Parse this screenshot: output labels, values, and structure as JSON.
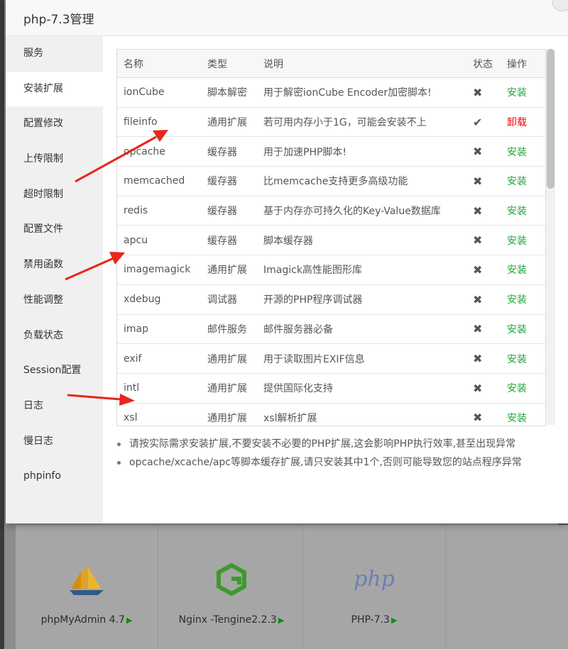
{
  "dialog": {
    "title": "php-7.3管理"
  },
  "sidebar": {
    "items": [
      {
        "label": "服务"
      },
      {
        "label": "安装扩展"
      },
      {
        "label": "配置修改"
      },
      {
        "label": "上传限制"
      },
      {
        "label": "超时限制"
      },
      {
        "label": "配置文件"
      },
      {
        "label": "禁用函数"
      },
      {
        "label": "性能调整"
      },
      {
        "label": "负载状态"
      },
      {
        "label": "Session配置"
      },
      {
        "label": "日志"
      },
      {
        "label": "慢日志"
      },
      {
        "label": "phpinfo"
      }
    ],
    "active_index": 1
  },
  "table": {
    "headers": {
      "name": "名称",
      "type": "类型",
      "desc": "说明",
      "status": "状态",
      "action": "操作"
    },
    "rows": [
      {
        "name": "ionCube",
        "type": "脚本解密",
        "desc": "用于解密ionCube Encoder加密脚本!",
        "status": "✖",
        "installed": false,
        "action": "安装"
      },
      {
        "name": "fileinfo",
        "type": "通用扩展",
        "desc": "若可用内存小于1G，可能会安装不上",
        "status": "✔",
        "installed": true,
        "action": "卸载"
      },
      {
        "name": "opcache",
        "type": "缓存器",
        "desc": "用于加速PHP脚本!",
        "status": "✖",
        "installed": false,
        "action": "安装"
      },
      {
        "name": "memcached",
        "type": "缓存器",
        "desc": "比memcache支持更多高级功能",
        "status": "✖",
        "installed": false,
        "action": "安装"
      },
      {
        "name": "redis",
        "type": "缓存器",
        "desc": "基于内存亦可持久化的Key-Value数据库",
        "status": "✖",
        "installed": false,
        "action": "安装"
      },
      {
        "name": "apcu",
        "type": "缓存器",
        "desc": "脚本缓存器",
        "status": "✖",
        "installed": false,
        "action": "安装"
      },
      {
        "name": "imagemagick",
        "type": "通用扩展",
        "desc": "Imagick高性能图形库",
        "status": "✖",
        "installed": false,
        "action": "安装"
      },
      {
        "name": "xdebug",
        "type": "调试器",
        "desc": "开源的PHP程序调试器",
        "status": "✖",
        "installed": false,
        "action": "安装"
      },
      {
        "name": "imap",
        "type": "邮件服务",
        "desc": "邮件服务器必备",
        "status": "✖",
        "installed": false,
        "action": "安装"
      },
      {
        "name": "exif",
        "type": "通用扩展",
        "desc": "用于读取图片EXIF信息",
        "status": "✖",
        "installed": false,
        "action": "安装"
      },
      {
        "name": "intl",
        "type": "通用扩展",
        "desc": "提供国际化支持",
        "status": "✖",
        "installed": false,
        "action": "安装"
      },
      {
        "name": "xsl",
        "type": "通用扩展",
        "desc": "xsl解析扩展",
        "status": "✖",
        "installed": false,
        "action": "安装"
      }
    ]
  },
  "tips": [
    "请按实际需求安装扩展,不要安装不必要的PHP扩展,这会影响PHP执行效率,甚至出现异常",
    "opcache/xcache/apc等脚本缓存扩展,请只安装其中1个,否则可能导致您的站点程序异常"
  ],
  "background_apps": [
    {
      "label": "phpMyAdmin 4.7",
      "icon": "sailboat-icon"
    },
    {
      "label": "Nginx -Tengine2.2.3",
      "icon": "tengine-g-icon"
    },
    {
      "label": "PHP-7.3",
      "icon": "php-logo-icon"
    }
  ],
  "colors": {
    "install": "#20a53a",
    "uninstall": "#ef0808",
    "annotation": "#e8261b"
  }
}
